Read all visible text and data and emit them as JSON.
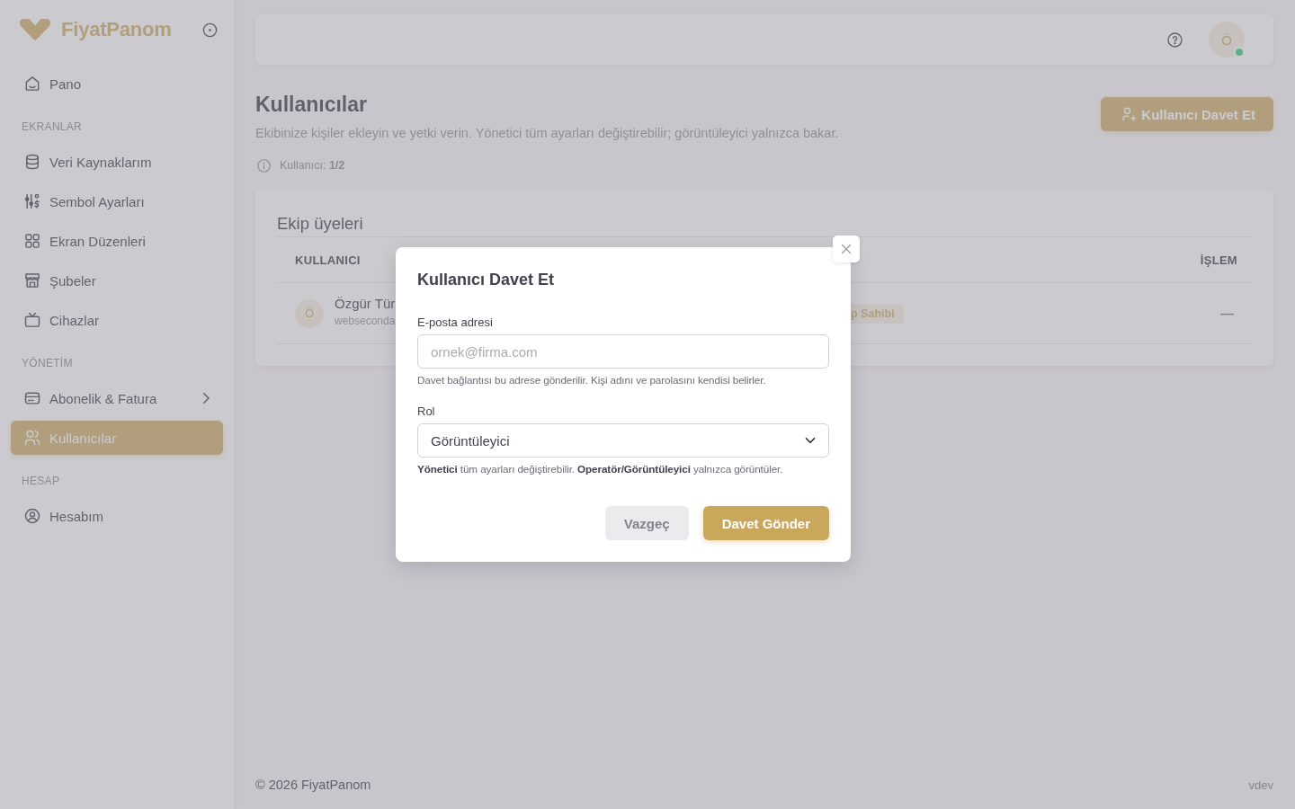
{
  "sidebar": {
    "brand": "FiyatPanom",
    "sections": [
      {
        "items": [
          {
            "label": "Pano",
            "selected": false,
            "submenu": false
          }
        ]
      },
      {
        "heading": "EKRANLAR",
        "items": [
          {
            "label": "Veri Kaynaklarım",
            "selected": false,
            "submenu": false
          },
          {
            "label": "Sembol Ayarları",
            "selected": false,
            "submenu": false
          },
          {
            "label": "Ekran Düzenleri",
            "selected": false,
            "submenu": false
          },
          {
            "label": "Şubeler",
            "selected": false,
            "submenu": false
          },
          {
            "label": "Cihazlar",
            "selected": false,
            "submenu": false
          }
        ]
      },
      {
        "heading": "YÖNETİM",
        "items": [
          {
            "label": "Abonelik & Fatura",
            "selected": false,
            "submenu": true
          },
          {
            "label": "Kullanıcılar",
            "selected": true,
            "submenu": false
          }
        ]
      },
      {
        "heading": "HESAP",
        "items": [
          {
            "label": "Hesabım",
            "selected": false,
            "submenu": false
          }
        ]
      }
    ]
  },
  "topbar": {
    "avatar": {
      "initial": "Ö",
      "online": true
    }
  },
  "page": {
    "title": "Kullanıcılar",
    "subtitle": "Ekibinize kişiler ekleyin ve yetki verin. Yönetici tüm ayarları değiştirebilir; görüntüleyici yalnızca bakar.",
    "quota": "Kullanıcı: **1/2**",
    "invite_button": "Kullanıcı Davet Et"
  },
  "members": {
    "title": "Ekip üyeleri",
    "columns": [
      "KULLANICI",
      "İŞLEM"
    ],
    "rows": [
      {
        "initial": "Ö",
        "name": "Özgür Tür",
        "email": "webseconda",
        "badge": "p Sahibi",
        "action": "—"
      }
    ]
  },
  "modal": {
    "title": "Kullanıcı Davet Et",
    "fields": [
      {
        "kind": "input",
        "label": "E-posta adresi",
        "placeholder": "ornek@firma.com",
        "hint": "Davet bağlantısı bu adrese gönderilir. Kişi adını ve parolasını kendisi belirler."
      },
      {
        "kind": "select",
        "label": "Rol",
        "value": "Görüntüleyici",
        "hint": "**Yönetici** tüm ayarları değiştirebilir. **Operatör/Görüntüleyici** yalnızca görüntüler."
      }
    ],
    "buttons": [
      {
        "label": "Vazgeç",
        "kind": "secondary"
      },
      {
        "label": "Davet Gönder",
        "kind": "primary"
      }
    ]
  },
  "footer": {
    "copyright": "© 2026 FiyatPanom",
    "version": "vdev"
  }
}
